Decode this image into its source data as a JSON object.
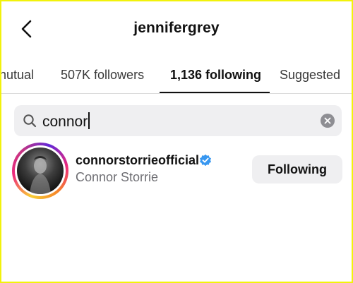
{
  "header": {
    "title": "jennifergrey",
    "back_icon": "chevron-left-icon"
  },
  "tabs": [
    {
      "label": "nutual",
      "active": false
    },
    {
      "label": "507K followers",
      "active": false
    },
    {
      "label": "1,136 following",
      "active": true
    },
    {
      "label": "Suggested",
      "active": false
    }
  ],
  "search": {
    "value": "connor",
    "icon": "search-icon",
    "clear_icon": "clear-icon"
  },
  "results": [
    {
      "username": "connorstorrieofficial",
      "full_name": "Connor Storrie",
      "verified": true,
      "button_label": "Following"
    }
  ],
  "colors": {
    "frame_border": "#f2f20a",
    "verified_badge": "#3897f0",
    "button_bg": "#efeff1",
    "secondary_text": "#6e6e73"
  }
}
